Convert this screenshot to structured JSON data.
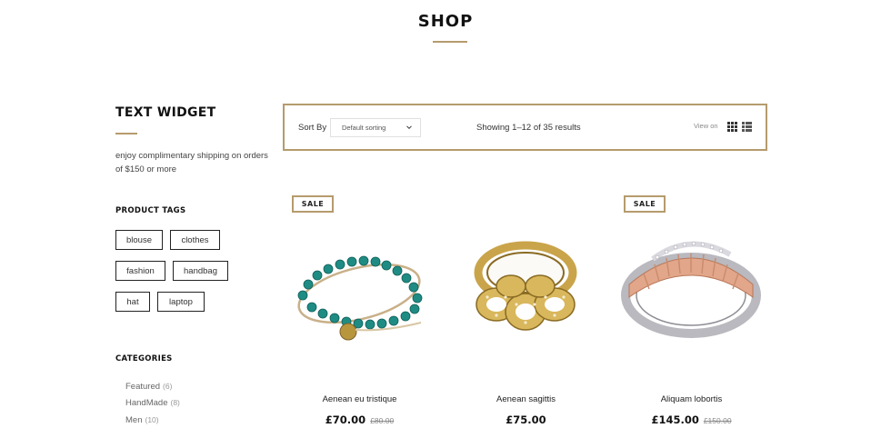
{
  "page": {
    "title": "SHOP"
  },
  "sidebar": {
    "text_widget": {
      "title": "TEXT WIDGET",
      "text": "enjoy complimentary shipping on orders of $150 or more"
    },
    "product_tags": {
      "title": "PRODUCT TAGS",
      "tags": [
        "blouse",
        "clothes",
        "fashion",
        "handbag",
        "hat",
        "laptop"
      ]
    },
    "categories": {
      "title": "CATEGORIES",
      "items": [
        {
          "label": "Featured",
          "count": "(6)"
        },
        {
          "label": "HandMade",
          "count": "(8)"
        },
        {
          "label": "Men",
          "count": "(10)"
        }
      ]
    }
  },
  "toolbar": {
    "sort_label": "Sort By",
    "sort_value": "Default sorting",
    "result_count": "Showing 1–12 of 35 results",
    "view_on": "View on"
  },
  "products": [
    {
      "name": "Aenean eu tristique",
      "price": "£70.00",
      "old_price": "£80.00",
      "badge": "SALE",
      "image": "turquoise-bead-bracelet"
    },
    {
      "name": "Aenean sagittis",
      "price": "£75.00",
      "old_price": "",
      "badge": "",
      "image": "gold-chain-crystal-ring"
    },
    {
      "name": "Aliquam lobortis",
      "price": "£145.00",
      "old_price": "£150.00",
      "badge": "SALE",
      "image": "rose-gold-diamond-ring"
    }
  ],
  "colors": {
    "accent": "#b59b6d",
    "text": "#222222"
  }
}
